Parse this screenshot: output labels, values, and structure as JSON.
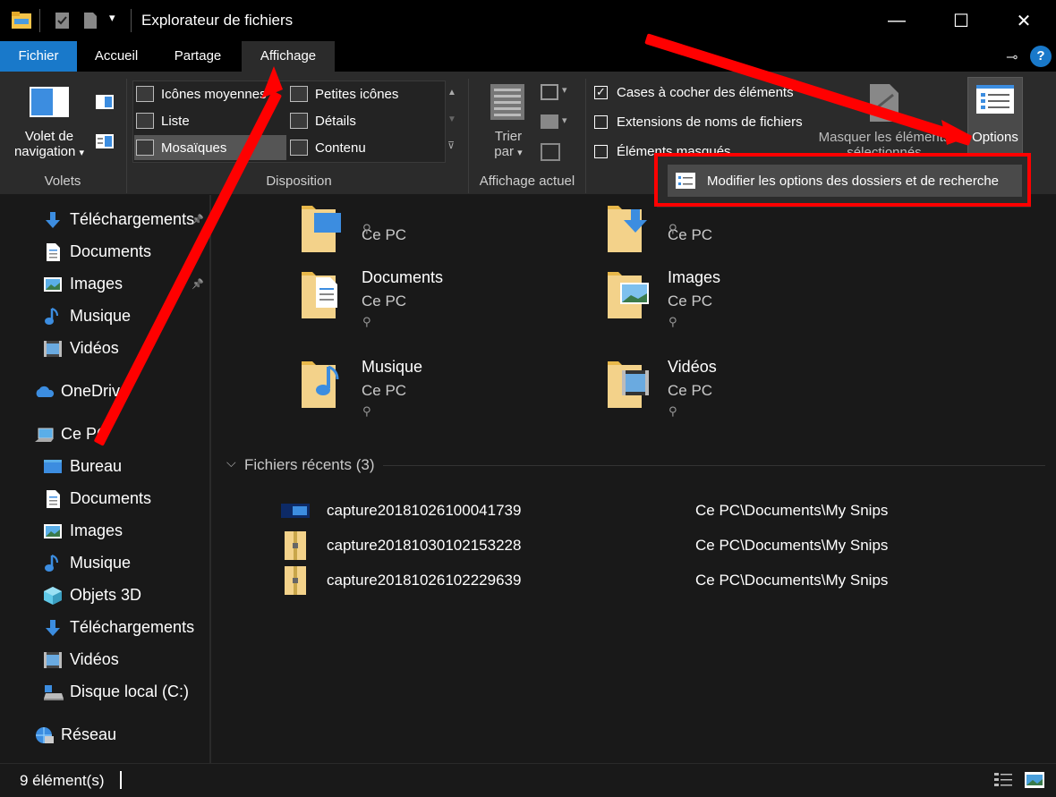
{
  "window": {
    "title": "Explorateur de fichiers",
    "minimize": "—",
    "maximize": "☐",
    "close": "✕"
  },
  "tabs": [
    "Fichier",
    "Accueil",
    "Partage",
    "Affichage"
  ],
  "ribbon": {
    "volets": {
      "nav_label_1": "Volet de",
      "nav_label_2": "navigation",
      "group": "Volets"
    },
    "disposition": {
      "items": [
        "Icônes moyennes",
        "Petites icônes",
        "Liste",
        "Détails",
        "Mosaïques",
        "Contenu"
      ],
      "group": "Disposition"
    },
    "affichage_actuel": {
      "sort_label_1": "Trier",
      "sort_label_2": "par",
      "group": "Affichage actuel"
    },
    "show_hide": {
      "checkboxes": [
        {
          "label": "Cases à cocher des éléments",
          "checked": true
        },
        {
          "label": "Extensions de noms de fichiers",
          "checked": false
        },
        {
          "label": "Éléments masqués",
          "checked": false
        }
      ],
      "hide_selected_1": "Masquer les éléments",
      "hide_selected_2": "sélectionnés"
    },
    "options": {
      "label": "Options"
    }
  },
  "dropdown": {
    "item": "Modifier les options des dossiers et de recherche"
  },
  "sidebar": {
    "items": [
      {
        "label": "Téléchargements",
        "pinned": true,
        "icon": "download-icon"
      },
      {
        "label": "Documents",
        "pinned": true,
        "icon": "document-icon"
      },
      {
        "label": "Images",
        "pinned": true,
        "icon": "image-icon"
      },
      {
        "label": "Musique",
        "pinned": false,
        "icon": "music-icon"
      },
      {
        "label": "Vidéos",
        "pinned": false,
        "icon": "video-icon"
      },
      {
        "label": "OneDrive",
        "pinned": false,
        "icon": "cloud-icon"
      },
      {
        "label": "Ce PC",
        "pinned": false,
        "icon": "computer-icon"
      },
      {
        "label": "Bureau",
        "pinned": false,
        "icon": "desktop-icon"
      },
      {
        "label": "Documents",
        "pinned": false,
        "icon": "document-icon"
      },
      {
        "label": "Images",
        "pinned": false,
        "icon": "image-icon"
      },
      {
        "label": "Musique",
        "pinned": false,
        "icon": "music-icon"
      },
      {
        "label": "Objets 3D",
        "pinned": false,
        "icon": "cube-icon"
      },
      {
        "label": "Téléchargements",
        "pinned": false,
        "icon": "download-icon"
      },
      {
        "label": "Vidéos",
        "pinned": false,
        "icon": "video-icon"
      },
      {
        "label": "Disque local (C:)",
        "pinned": false,
        "icon": "drive-icon"
      },
      {
        "label": "Réseau",
        "pinned": false,
        "icon": "network-icon"
      }
    ]
  },
  "quick_access": [
    {
      "name": "",
      "location": "Ce PC"
    },
    {
      "name": "",
      "location": "Ce PC"
    },
    {
      "name": "Documents",
      "location": "Ce PC"
    },
    {
      "name": "Images",
      "location": "Ce PC"
    },
    {
      "name": "Musique",
      "location": "Ce PC"
    },
    {
      "name": "Vidéos",
      "location": "Ce PC"
    }
  ],
  "recent": {
    "header": "Fichiers récents (3)",
    "files": [
      {
        "name": "capture20181026100041739",
        "path": "Ce PC\\Documents\\My Snips"
      },
      {
        "name": "capture20181030102153228",
        "path": "Ce PC\\Documents\\My Snips"
      },
      {
        "name": "capture20181026102229639",
        "path": "Ce PC\\Documents\\My Snips"
      }
    ]
  },
  "status": {
    "count": "9 élément(s)"
  },
  "colors": {
    "accent": "#1979ca",
    "highlight": "#ff0000",
    "folder": "#f3d28a"
  }
}
